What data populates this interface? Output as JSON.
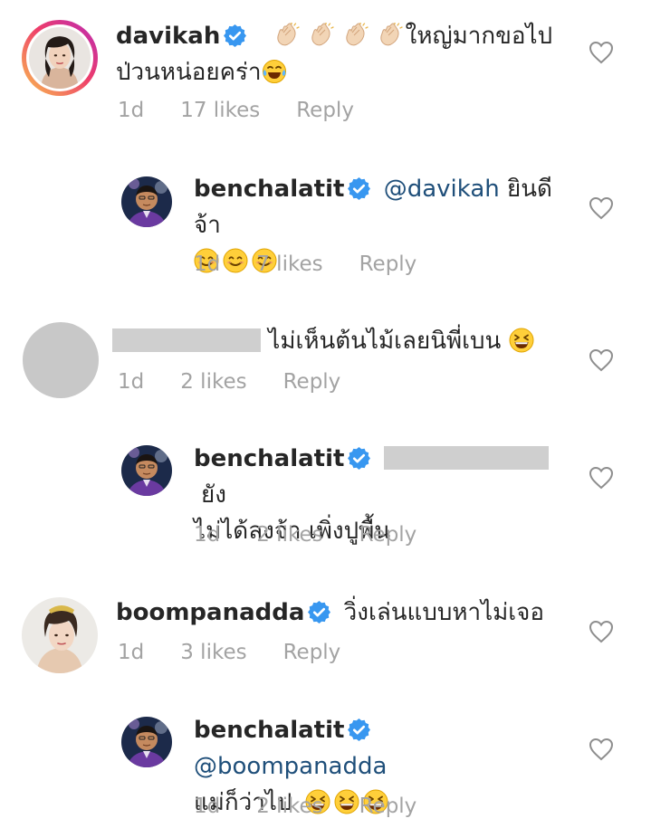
{
  "comments": [
    {
      "username": "davikah",
      "text": "ใหญ่มากขอไป",
      "text2": "ป่วนหน่อยคร่า",
      "time": "1d",
      "likes": "17 likes",
      "reply": "Reply",
      "emojis_before": [
        "clap-hands",
        "clap-hands",
        "clap-hands",
        "clap-hands"
      ],
      "emojis_after": [
        "laughing-tears"
      ]
    },
    {
      "username": "benchalatit",
      "mention": "@davikah",
      "text": "ยินดีจ้า",
      "time": "1d",
      "likes": "7 likes",
      "reply": "Reply",
      "emojis": [
        "smile",
        "smile",
        "smile"
      ]
    },
    {
      "username": "",
      "text": "ไม่เห็นต้นไม้เลยนิพี่เบน",
      "time": "1d",
      "likes": "2 likes",
      "reply": "Reply",
      "emojis": [
        "grin-squint"
      ]
    },
    {
      "username": "benchalatit",
      "text": "ยัง",
      "text2": "ไม่ได้ลงจ้า เพิ่งปูพื้น",
      "time": "1d",
      "likes": "2 likes",
      "reply": "Reply"
    },
    {
      "username": "boompanadda",
      "text": "วิ่งเล่นแบบหาไม่เจอ",
      "time": "1d",
      "likes": "3 likes",
      "reply": "Reply"
    },
    {
      "username": "benchalatit",
      "mention": "@boompanadda",
      "text2": "แม่ก็ว่าไป",
      "time": "1d",
      "likes": "2 likes",
      "reply": "Reply",
      "emojis": [
        "grin-squint",
        "grin-squint",
        "grin-squint"
      ]
    }
  ],
  "colors": {
    "text": "#262626",
    "meta": "#a3a3a3",
    "mention": "#1f4f7a",
    "verified": "#3897f0",
    "redaction": "#cfcfcf"
  },
  "icons": {
    "verified": "verified-badge-icon",
    "like": "heart-outline-icon"
  }
}
